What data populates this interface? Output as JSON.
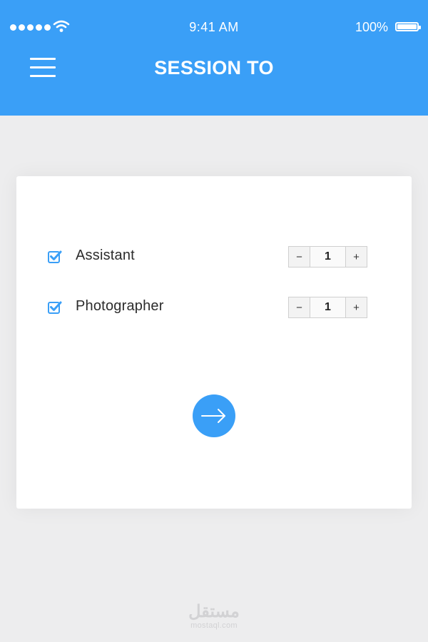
{
  "status_bar": {
    "time": "9:41 AM",
    "battery_percent": "100%",
    "signal_icon": "signal-dots-icon",
    "wifi_icon": "wifi-icon",
    "battery_icon": "battery-icon"
  },
  "header": {
    "title": "SESSION TO",
    "menu_icon": "hamburger-menu-icon",
    "background_color": "#3a9ff7"
  },
  "options": [
    {
      "label": "Assistant",
      "checked": true,
      "quantity": "1",
      "decrement": "−",
      "increment": "+"
    },
    {
      "label": "Photographer",
      "checked": true,
      "quantity": "1",
      "decrement": "−",
      "increment": "+"
    }
  ],
  "next_button": {
    "icon": "arrow-right-icon",
    "color": "#3a9ff7"
  },
  "watermark": {
    "arabic": "مستقل",
    "latin": "mostaql.com"
  }
}
